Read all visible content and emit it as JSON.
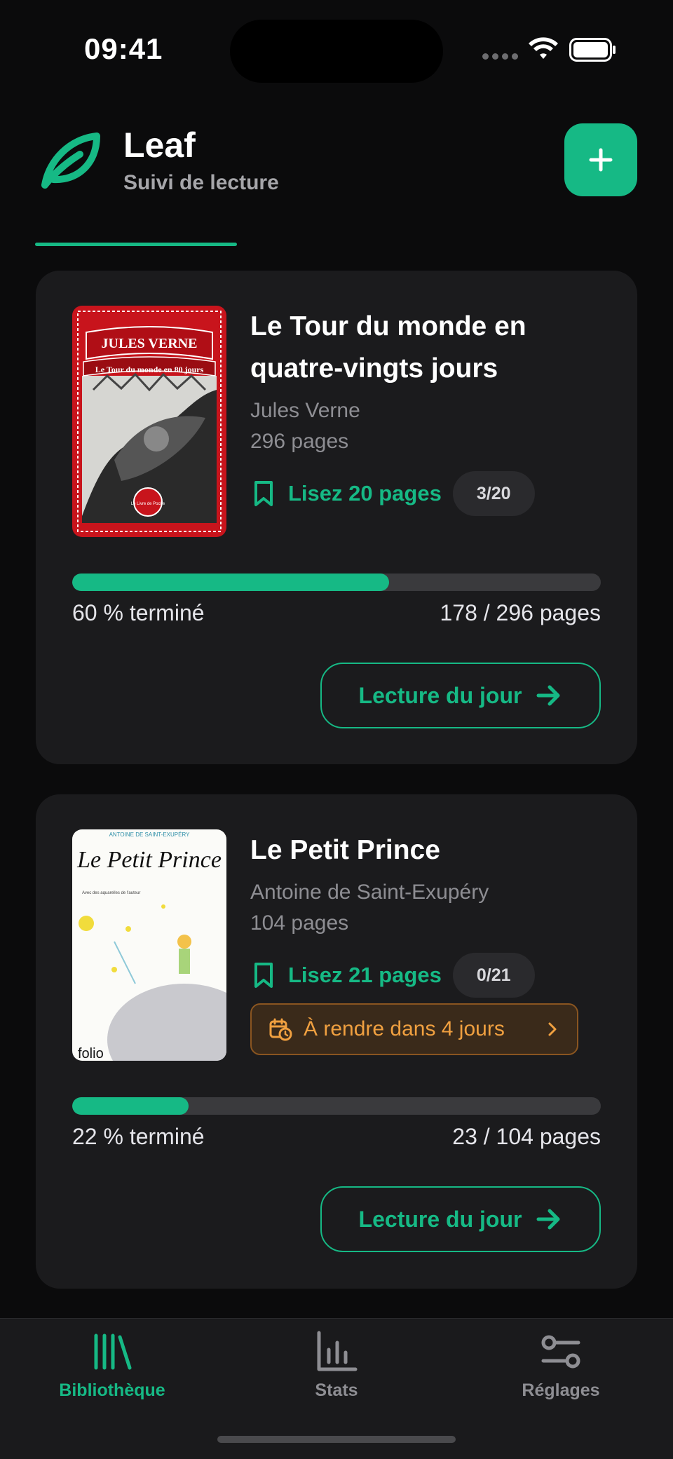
{
  "status_bar": {
    "time": "09:41"
  },
  "header": {
    "title": "Leaf",
    "subtitle": "Suivi de lecture",
    "add_icon": "plus-icon",
    "logo_icon": "leaf-icon",
    "accent_color": "#16b985"
  },
  "books": [
    {
      "title": "Le Tour du monde en quatre-vingts jours",
      "author": "Jules Verne",
      "pages": "296 pages",
      "cover": {
        "top_text": "JULES VERNE",
        "banner_text": "Le Tour du monde en 80 jours",
        "badge_text": "Le Livre de Poche"
      },
      "goal_text": "Lisez 20 pages",
      "goal_badge": "3/20",
      "progress": 0.6,
      "progress_label": "60 % terminé",
      "progress_pages": "178 / 296 pages",
      "button_label": "Lecture du jour"
    },
    {
      "title": "Le Petit Prince",
      "author": "Antoine de Saint-Exupéry",
      "pages": "104 pages",
      "cover": {
        "top_text": "ANTOINE DE SAINT-EXUPÉRY",
        "banner_text": "Le Petit Prince",
        "sub_text": "Avec des aquarelles de l'auteur",
        "badge_text": "folio"
      },
      "goal_text": "Lisez 21 pages",
      "goal_badge": "0/21",
      "due_text": "À rendre dans 4 jours",
      "due_color": "#f0a040",
      "progress": 0.22,
      "progress_label": "22 % terminé",
      "progress_pages": "23 / 104 pages",
      "button_label": "Lecture du jour"
    }
  ],
  "tab_bar": {
    "tabs": [
      {
        "label": "Bibliothèque",
        "icon": "library-icon",
        "active": true
      },
      {
        "label": "Stats",
        "icon": "chart-icon",
        "active": false
      },
      {
        "label": "Réglages",
        "icon": "sliders-icon",
        "active": false
      }
    ]
  }
}
